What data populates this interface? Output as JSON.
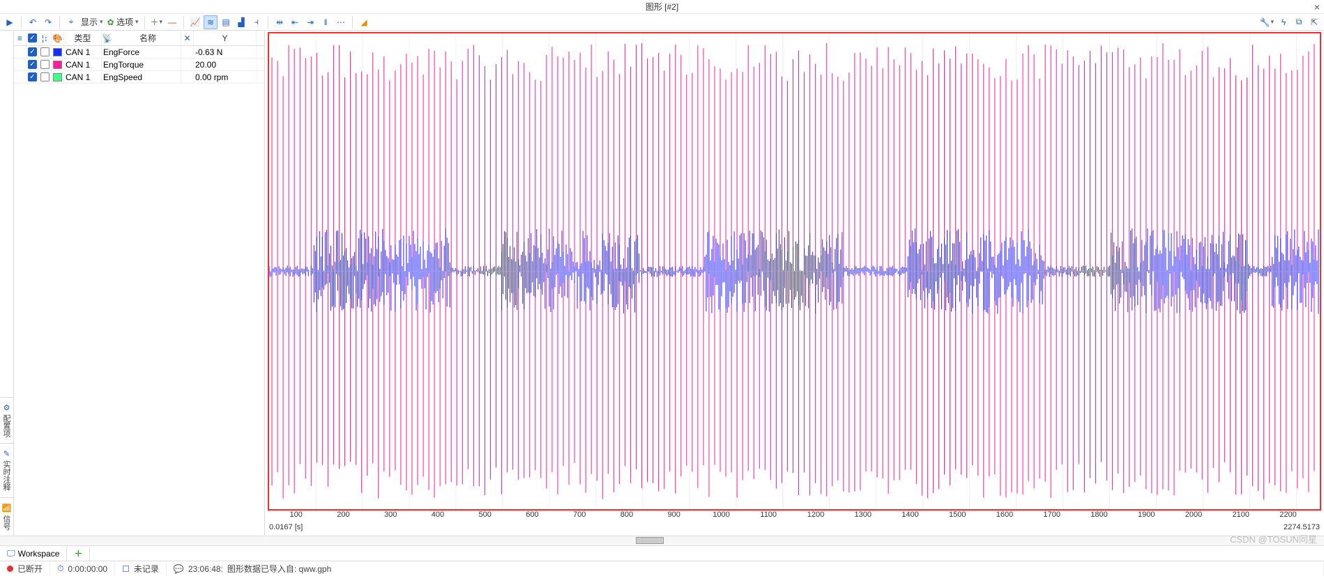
{
  "window": {
    "title": "图形 [#2]"
  },
  "toolbar": {
    "display_label": "显示",
    "options_label": "选项"
  },
  "columns": {
    "type": "类型",
    "name": "名称",
    "y": "Y"
  },
  "signals": [
    {
      "checked1": true,
      "checked2": false,
      "color": "#1030ff",
      "type": "CAN 1",
      "name": "EngForce",
      "y": "-0.63 N"
    },
    {
      "checked1": true,
      "checked2": false,
      "color": "#ff1aa0",
      "type": "CAN 1",
      "name": "EngTorque",
      "y": "20.00"
    },
    {
      "checked1": true,
      "checked2": false,
      "color": "#3cff8a",
      "type": "CAN 1",
      "name": "EngSpeed",
      "y": "0.00 rpm"
    }
  ],
  "sidetabs": {
    "config": "配置项",
    "annot": "实时注释",
    "signal": "信号"
  },
  "xaxis": {
    "ticks": [
      "100",
      "200",
      "300",
      "400",
      "500",
      "600",
      "700",
      "800",
      "900",
      "1000",
      "1100",
      "1200",
      "1300",
      "1400",
      "1500",
      "1600",
      "1700",
      "1800",
      "1900",
      "2000",
      "2100",
      "2200"
    ],
    "start_label": "0.0167 [s]",
    "end_label": "2274.5173"
  },
  "workspace": {
    "tab": "Workspace"
  },
  "status": {
    "conn": "已断开",
    "time": "0:00:00:00",
    "rec": "未记录",
    "msg_time": "23:06:48:",
    "msg": "图形数据已导入自: qww.gph"
  },
  "watermark": "CSDN @TOSUN同星",
  "chart_data": {
    "type": "line",
    "title": "",
    "xlabel": "[s]",
    "xlim": [
      0.0167,
      2274.5173
    ],
    "ylabel": "",
    "series": [
      {
        "name": "EngTorque",
        "color": "#ff1aa0",
        "note": "dense periodic spikes full height approx every ~12 s",
        "sample_current": 20.0
      },
      {
        "name": "EngForce",
        "color": "#1030ff",
        "note": "noise band around center, ~5 bursts",
        "sample_current": -0.63
      },
      {
        "name": "EngSpeed",
        "color": "#3cff8a",
        "note": "flat near zero baseline",
        "sample_current": 0.0
      }
    ],
    "x_ticks": [
      100,
      200,
      300,
      400,
      500,
      600,
      700,
      800,
      900,
      1000,
      1100,
      1200,
      1300,
      1400,
      1500,
      1600,
      1700,
      1800,
      1900,
      2000,
      2100,
      2200
    ]
  }
}
